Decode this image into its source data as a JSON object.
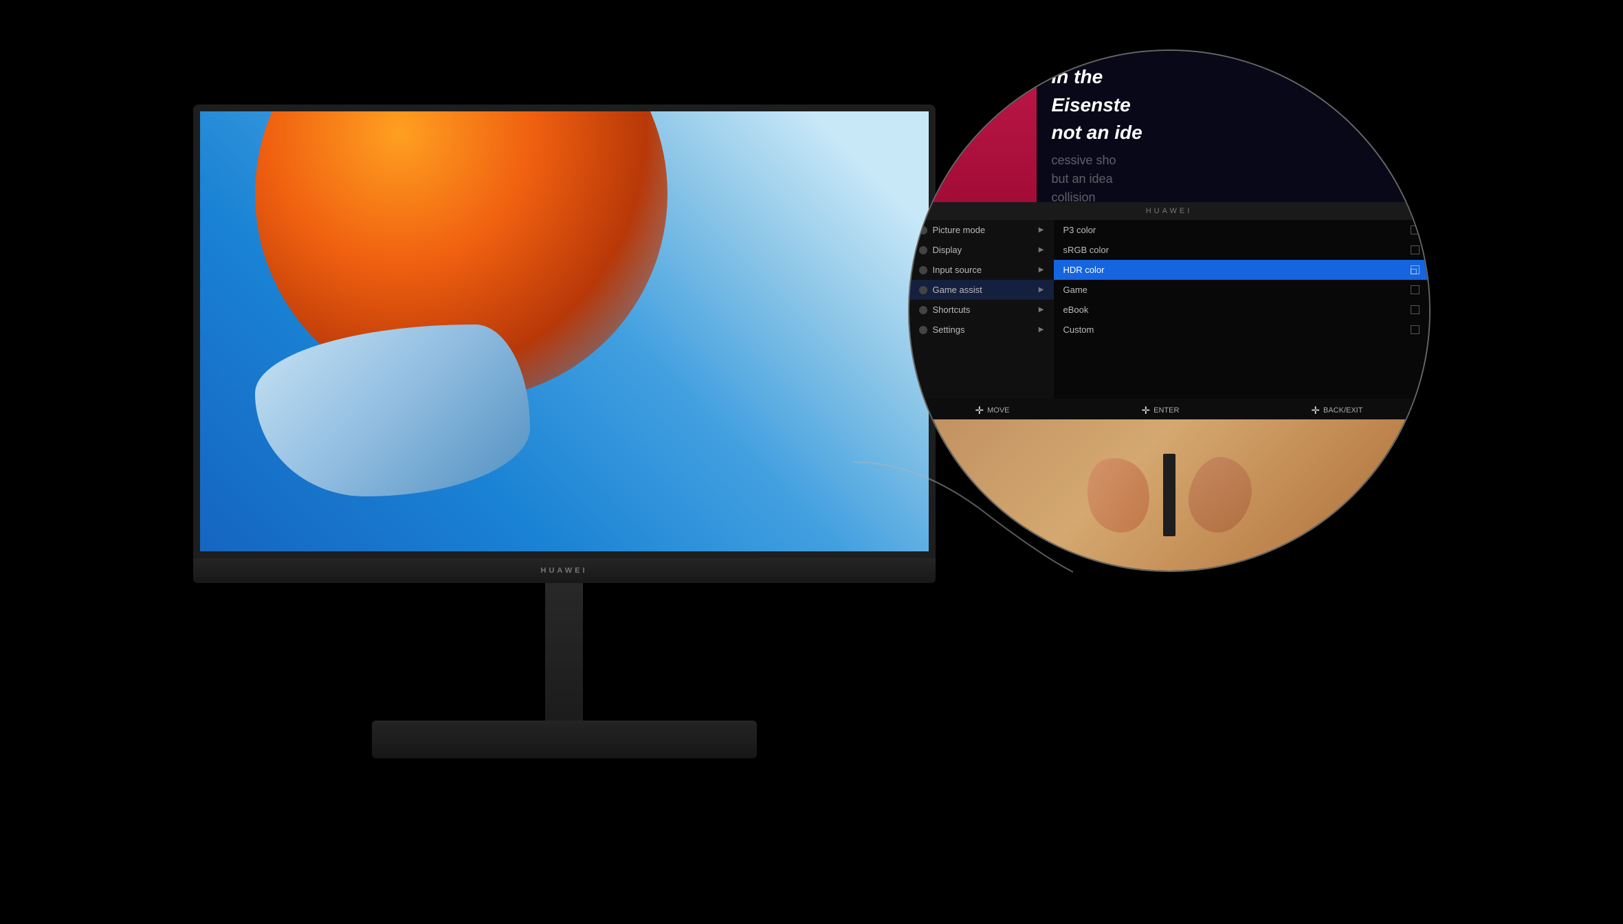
{
  "monitor": {
    "brand": "HUAWEI",
    "bezel_brand": "HUAWEI"
  },
  "zoom_circle": {
    "article": {
      "text_line1": "In the",
      "text_line2": "Eisenste",
      "text_line3": "not an ide",
      "subtext1": "cessive sho",
      "subtext2": "but an idea",
      "subtext3": "collision"
    },
    "osd": {
      "header_brand": "HUAWEI",
      "left_menu": [
        {
          "label": "Picture mode",
          "has_arrow": true
        },
        {
          "label": "Display",
          "has_arrow": true
        },
        {
          "label": "Input source",
          "has_arrow": true
        },
        {
          "label": "Game assist",
          "has_arrow": true,
          "highlighted": true
        },
        {
          "label": "Shortcuts",
          "has_arrow": true
        },
        {
          "label": "Settings",
          "has_arrow": true
        }
      ],
      "right_menu": [
        {
          "label": "P3 color",
          "selected": false
        },
        {
          "label": "sRGB color",
          "selected": false
        },
        {
          "label": "HDR color",
          "selected": true
        },
        {
          "label": "Game",
          "selected": false
        },
        {
          "label": "eBook",
          "selected": false
        },
        {
          "label": "Custom",
          "selected": false
        }
      ],
      "nav_items": [
        {
          "icon": "✛",
          "label": "MOVE"
        },
        {
          "icon": "✛",
          "label": "ENTER"
        },
        {
          "icon": "✛",
          "label": "BACK/EXIT"
        }
      ]
    }
  }
}
